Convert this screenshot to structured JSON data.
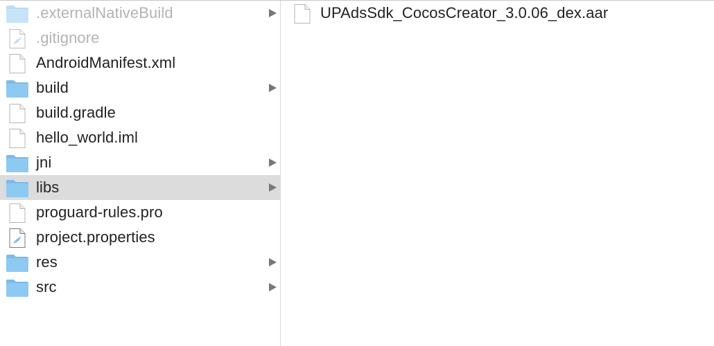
{
  "left_column": {
    "items": [
      {
        "label": ".externalNativeBuild",
        "type": "folder",
        "icon": "folder-icon",
        "hidden": true,
        "has_children": true,
        "selected": false
      },
      {
        "label": ".gitignore",
        "type": "file-swift",
        "icon": "feather-document-icon",
        "hidden": true,
        "has_children": false,
        "selected": false
      },
      {
        "label": "AndroidManifest.xml",
        "type": "file",
        "icon": "document-icon",
        "hidden": false,
        "has_children": false,
        "selected": false
      },
      {
        "label": "build",
        "type": "folder",
        "icon": "folder-icon",
        "hidden": false,
        "has_children": true,
        "selected": false
      },
      {
        "label": "build.gradle",
        "type": "file",
        "icon": "document-icon",
        "hidden": false,
        "has_children": false,
        "selected": false
      },
      {
        "label": "hello_world.iml",
        "type": "file",
        "icon": "document-icon",
        "hidden": false,
        "has_children": false,
        "selected": false
      },
      {
        "label": "jni",
        "type": "folder",
        "icon": "folder-icon",
        "hidden": false,
        "has_children": true,
        "selected": false
      },
      {
        "label": "libs",
        "type": "folder",
        "icon": "folder-icon",
        "hidden": false,
        "has_children": true,
        "selected": true
      },
      {
        "label": "proguard-rules.pro",
        "type": "file",
        "icon": "document-icon",
        "hidden": false,
        "has_children": false,
        "selected": false
      },
      {
        "label": "project.properties",
        "type": "file-swift",
        "icon": "feather-document-icon",
        "hidden": false,
        "has_children": false,
        "selected": false
      },
      {
        "label": "res",
        "type": "folder",
        "icon": "folder-icon",
        "hidden": false,
        "has_children": true,
        "selected": false
      },
      {
        "label": "src",
        "type": "folder",
        "icon": "folder-icon",
        "hidden": false,
        "has_children": true,
        "selected": false
      }
    ]
  },
  "right_column": {
    "items": [
      {
        "label": "UPAdsSdk_CocosCreator_3.0.06_dex.aar",
        "type": "file",
        "icon": "document-icon",
        "hidden": false,
        "has_children": false,
        "selected": false
      }
    ]
  },
  "colors": {
    "folder_fill": "#8ec9f2",
    "folder_tab": "#7bbbe8",
    "selection": "#dcdcdc",
    "feather_accent": "#3a8fd8"
  }
}
